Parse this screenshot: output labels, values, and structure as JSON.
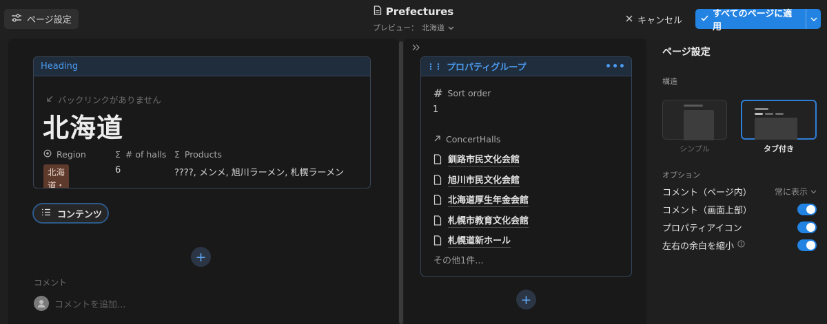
{
  "topbar": {
    "page_settings_label": "ページ設定",
    "title": "Prefectures",
    "preview_label": "プレビュー：",
    "preview_value": "北海道",
    "cancel_label": "キャンセル",
    "apply_label": "すべてのページに適用"
  },
  "heading_card": {
    "header": "Heading",
    "backlink": "バックリンクがありません",
    "page_title": "北海道",
    "props": [
      {
        "icon": "circle-target-icon",
        "label": "Region"
      },
      {
        "icon": "sigma-icon",
        "label": "# of halls"
      },
      {
        "icon": "sigma-icon",
        "label": "Products"
      }
    ],
    "region_tag": "北海道・東北",
    "halls_count": "6",
    "products": "????, メンメ, 旭川ラーメン, 札幌ラーメン"
  },
  "contents_button": "コンテンツ",
  "comments": {
    "label": "コメント",
    "placeholder": "コメントを追加..."
  },
  "property_group": {
    "header": "プロパティグループ",
    "sort_label": "Sort order",
    "sort_value": "1",
    "relation_label": "ConcertHalls",
    "halls": [
      "釧路市民文化会館",
      "旭川市民文化会館",
      "北海道厚生年金会館",
      "札幌市教育文化会館",
      "札幌道新ホール"
    ],
    "more": "その他1件..."
  },
  "settings_panel": {
    "title": "ページ設定",
    "structure_label": "構造",
    "layout_simple": "シンプル",
    "layout_tabbed": "タブ付き",
    "options_label": "オプション",
    "options": [
      {
        "label": "コメント（ページ内）",
        "value": "常に表示"
      },
      {
        "label": "コメント（画面上部）",
        "toggle": true
      },
      {
        "label": "プロパティアイコン",
        "toggle": true
      },
      {
        "label": "左右の余白を縮小",
        "toggle": true
      }
    ]
  },
  "colors": {
    "accent": "#2383e2",
    "tag_bg": "#5e3a2c",
    "header_blue": "#4b9bf0"
  }
}
